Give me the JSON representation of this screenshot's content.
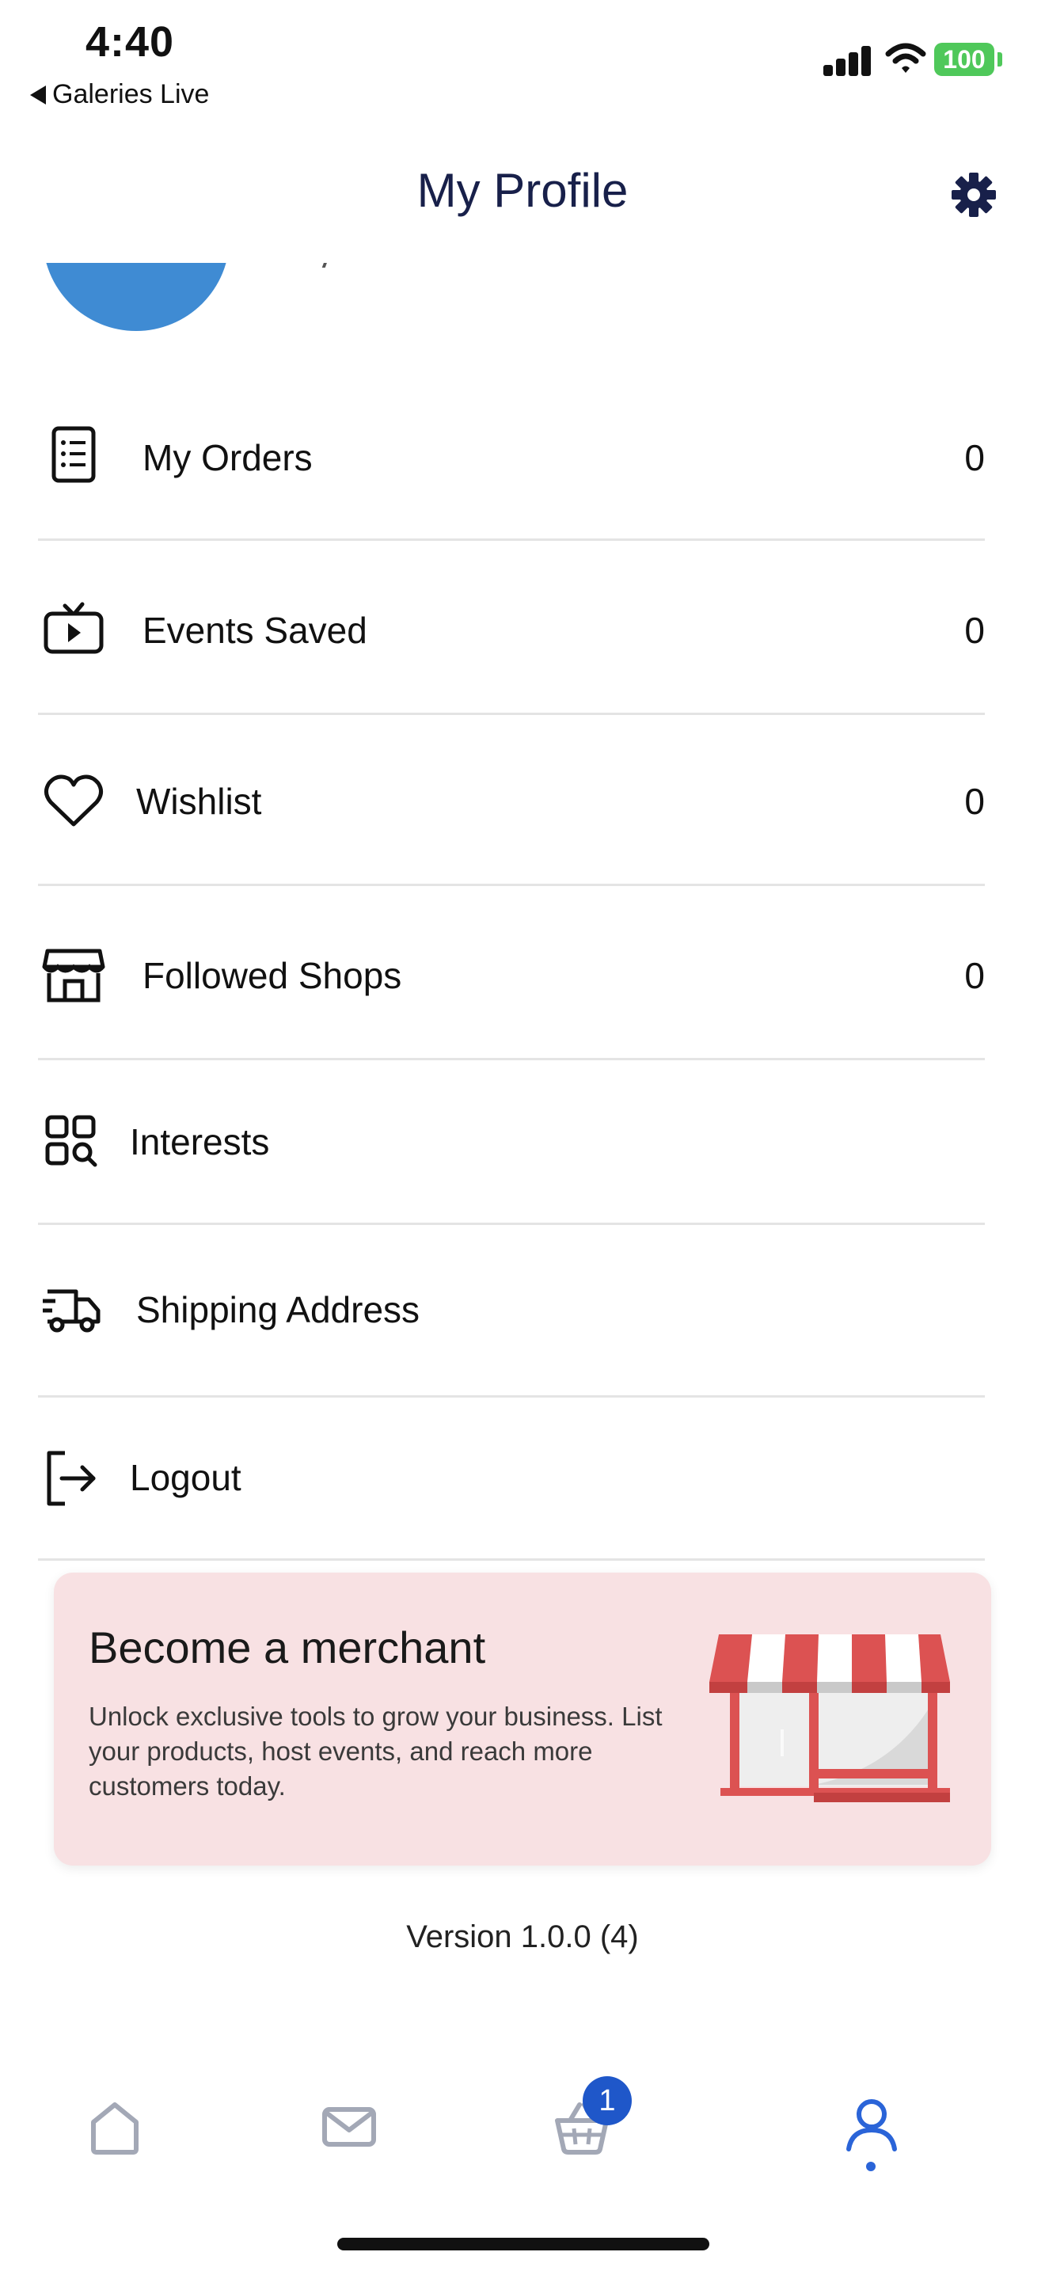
{
  "status_bar": {
    "time": "4:40",
    "back_app": "Galeries Live",
    "battery": "100"
  },
  "header": {
    "title": "My Profile",
    "settings_icon": "gear-icon"
  },
  "menu": {
    "items": [
      {
        "label": "My Orders",
        "count": "0",
        "icon": "orders-list-icon"
      },
      {
        "label": "Events Saved",
        "count": "0",
        "icon": "tv-play-icon"
      },
      {
        "label": "Wishlist",
        "count": "0",
        "icon": "heart-icon"
      },
      {
        "label": "Followed Shops",
        "count": "0",
        "icon": "storefront-icon"
      },
      {
        "label": "Interests",
        "icon": "category-search-icon"
      },
      {
        "label": "Shipping Address",
        "icon": "delivery-truck-icon"
      },
      {
        "label": "Logout",
        "icon": "logout-icon"
      }
    ]
  },
  "merchant": {
    "title": "Become a merchant",
    "description": "Unlock exclusive tools to grow your business. List your products, host events, and reach more customers today.",
    "accent_color": "#e05a5a"
  },
  "version": "Version 1.0.0 (4)",
  "tabbar": {
    "tabs": [
      {
        "icon": "home-icon"
      },
      {
        "icon": "mail-icon"
      },
      {
        "icon": "basket-icon",
        "badge": "1"
      },
      {
        "icon": "profile-icon",
        "active": true
      }
    ],
    "active_color": "#2a64d8"
  }
}
